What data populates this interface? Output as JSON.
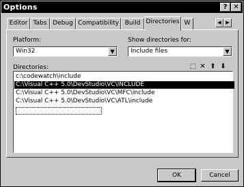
{
  "window": {
    "title": "Options",
    "help_button": "?",
    "close_button": "✕"
  },
  "tabs": [
    {
      "label": "Editor"
    },
    {
      "label": "Tabs"
    },
    {
      "label": "Debug"
    },
    {
      "label": "Compatibility"
    },
    {
      "label": "Build"
    },
    {
      "label": "Directories"
    },
    {
      "label": "W"
    }
  ],
  "tab_scroll": {
    "left": "◀",
    "right": "▶"
  },
  "platform": {
    "label": "Platform:",
    "value": "Win32",
    "arrow": "▼"
  },
  "show_dirs": {
    "label": "Show directories for:",
    "value": "Include files",
    "arrow": "▼"
  },
  "directories": {
    "label": "Directories:",
    "items": [
      "c:\\codewatch\\include",
      "C:\\Visual C++ 5.0\\DevStudio\\VC\\INCLUDE",
      "C:\\Visual C++ 5.0\\DevStudio\\VC\\MFC\\include",
      "C:\\Visual C++ 5.0\\DevStudio\\VC\\ATL\\include"
    ],
    "selected_index": 1
  },
  "toolbar": {
    "new_icon": "⬚",
    "delete_icon": "✕",
    "up_icon": "⬆",
    "down_icon": "⬇"
  },
  "buttons": {
    "ok": "OK",
    "cancel": "Cancel"
  }
}
